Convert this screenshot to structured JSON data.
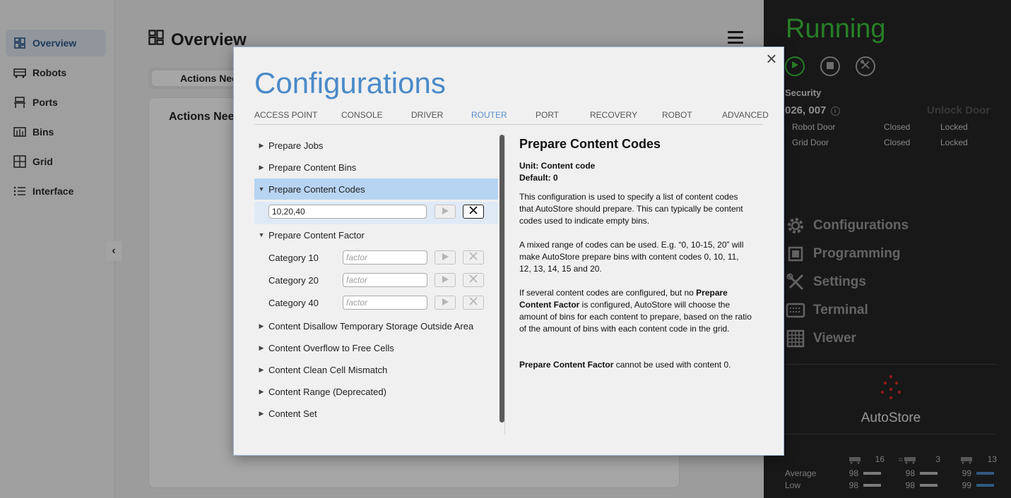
{
  "sidebar": {
    "items": [
      {
        "label": "Overview",
        "icon": "dashboard-icon",
        "active": true
      },
      {
        "label": "Robots",
        "icon": "robot-icon"
      },
      {
        "label": "Ports",
        "icon": "port-icon"
      },
      {
        "label": "Bins",
        "icon": "bins-icon"
      },
      {
        "label": "Grid",
        "icon": "grid-icon"
      },
      {
        "label": "Interface",
        "icon": "list-icon"
      }
    ],
    "collapse_glyph": "‹"
  },
  "main": {
    "title": "Overview",
    "tab_label": "Actions Needed",
    "card_title": "Actions Needed"
  },
  "right_panel": {
    "status": "Running",
    "status_color": "#3cc43c",
    "security_title": "Security",
    "door_ids": "026, 007",
    "unlock_label": "Unlock Door",
    "doors": [
      {
        "name": "Robot Door",
        "state": "Closed",
        "lock": "Locked"
      },
      {
        "name": "Grid Door",
        "state": "Closed",
        "lock": "Locked"
      }
    ],
    "menu": [
      {
        "label": "Configurations",
        "icon": "gear-icon"
      },
      {
        "label": "Programming",
        "icon": "chip-icon"
      },
      {
        "label": "Settings",
        "icon": "wrench-icon"
      },
      {
        "label": "Terminal",
        "icon": "terminal-icon"
      },
      {
        "label": "Viewer",
        "icon": "grid-viewer-icon"
      }
    ],
    "brand": "AutoStore",
    "robot_counts": [
      "16",
      "3",
      "13"
    ],
    "stats": {
      "average_label": "Average",
      "low_label": "Low",
      "average": [
        "98",
        "98",
        "99"
      ],
      "low": [
        "98",
        "98",
        "99"
      ]
    }
  },
  "modal": {
    "title": "Configurations",
    "close_glyph": "×",
    "tabs": [
      "ACCESS POINT",
      "CONSOLE",
      "DRIVER",
      "ROUTER",
      "PORT",
      "RECOVERY",
      "ROBOT",
      "ADVANCED"
    ],
    "active_tab": "ROUTER",
    "tree": {
      "prepare_jobs": "Prepare Jobs",
      "prepare_content_bins": "Prepare Content Bins",
      "prepare_content_codes": "Prepare Content Codes",
      "content_codes_value": "10,20,40",
      "prepare_content_factor": "Prepare Content Factor",
      "categories": [
        "Category 10",
        "Category 20",
        "Category 40"
      ],
      "factor_placeholder": "factor",
      "rest": [
        "Content Disallow Temporary Storage Outside Area",
        "Content Overflow to Free Cells",
        "Content Clean Cell Mismatch",
        "Content Range (Deprecated)",
        "Content Set"
      ]
    },
    "description": {
      "heading": "Prepare Content Codes",
      "unit": "Unit: Content code",
      "default": "Default: 0",
      "p1": "This configuration is used to specify a list of content codes that AutoStore should prepare. This can typically be content codes used to indicate empty bins.",
      "p2": "A mixed range of codes can be used. E.g. “0, 10-15, 20” will make AutoStore prepare bins with content codes 0, 10, 11, 12, 13, 14, 15 and 20.",
      "p3_a": "If several content codes are configured, but no ",
      "p3_b": "Prepare Content Factor",
      "p3_c": " is configured, AutoStore will choose the amount of bins for each content to prepare, based on the ratio of the amount of bins with each content code in the grid.",
      "p4_a": "Prepare Content Factor",
      "p4_b": " cannot be used with content 0."
    }
  }
}
